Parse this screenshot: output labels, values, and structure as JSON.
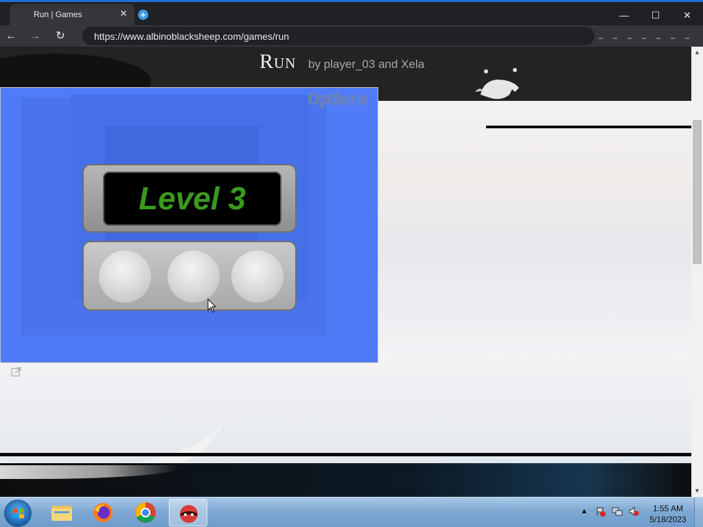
{
  "browser": {
    "tab_title": "Run | Games",
    "tab_close": "✕",
    "new_tab": "+",
    "url": "https://www.albinoblacksheep.com/games/run",
    "back": "←",
    "forward": "→",
    "reload": "↻",
    "minimize": "—",
    "maximize": "☐",
    "close": "✕"
  },
  "page": {
    "title": "Run",
    "author": "by player_03 and Xela"
  },
  "game": {
    "options_label": "Options",
    "level_text": "Level 3",
    "lives_remaining": 3
  },
  "scrollbar": {
    "up": "▲",
    "down": "▼"
  },
  "taskbar": {
    "apps": [
      "file-explorer",
      "firefox",
      "chrome",
      "game-app"
    ],
    "time": "1:55 AM",
    "date": "5/18/2023",
    "tray_expand": "▲"
  },
  "colors": {
    "game_bg": "#4f7bf7",
    "level_text": "#3a9a1e",
    "chrome_dark": "#202124",
    "taskbar": "#7fa9d3"
  }
}
